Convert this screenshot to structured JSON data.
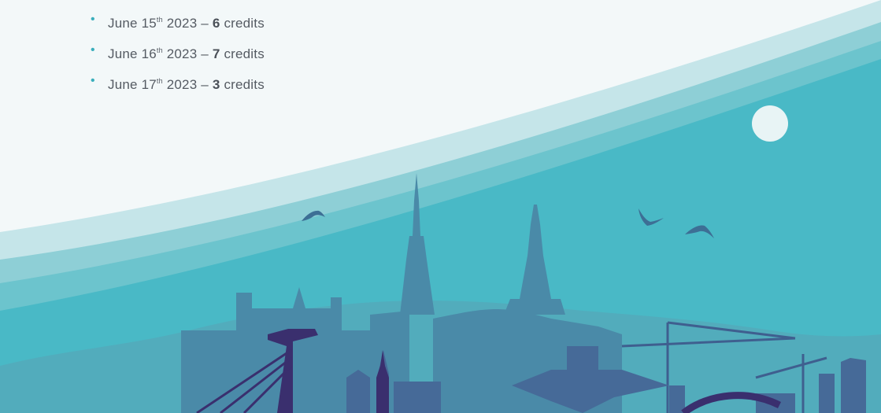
{
  "credit_days": [
    {
      "day_prefix": "June 15",
      "ordinal": "th",
      "year_sep": " 2023 – ",
      "credits": "6",
      "unit": " credits"
    },
    {
      "day_prefix": "June 16",
      "ordinal": "th",
      "year_sep": " 2023 – ",
      "credits": "7",
      "unit": " credits"
    },
    {
      "day_prefix": "June 17",
      "ordinal": "th",
      "year_sep": " 2023 – ",
      "credits": "3",
      "unit": " credits"
    }
  ],
  "bullet_glyph": "•",
  "colors": {
    "background": "#f3f8f9",
    "arc_light": "#c5e5e9",
    "arc_mid": "#8ecfd6",
    "teal": "#49b9c6",
    "skyline_far": "#3f8fa6",
    "skyline_mid": "#466a98",
    "skyline_dark": "#3a2f6e",
    "moon": "#e8f4f5"
  },
  "icons": [
    "bullet-icon",
    "moon-icon",
    "bird-icon",
    "city-skyline-illustration"
  ]
}
